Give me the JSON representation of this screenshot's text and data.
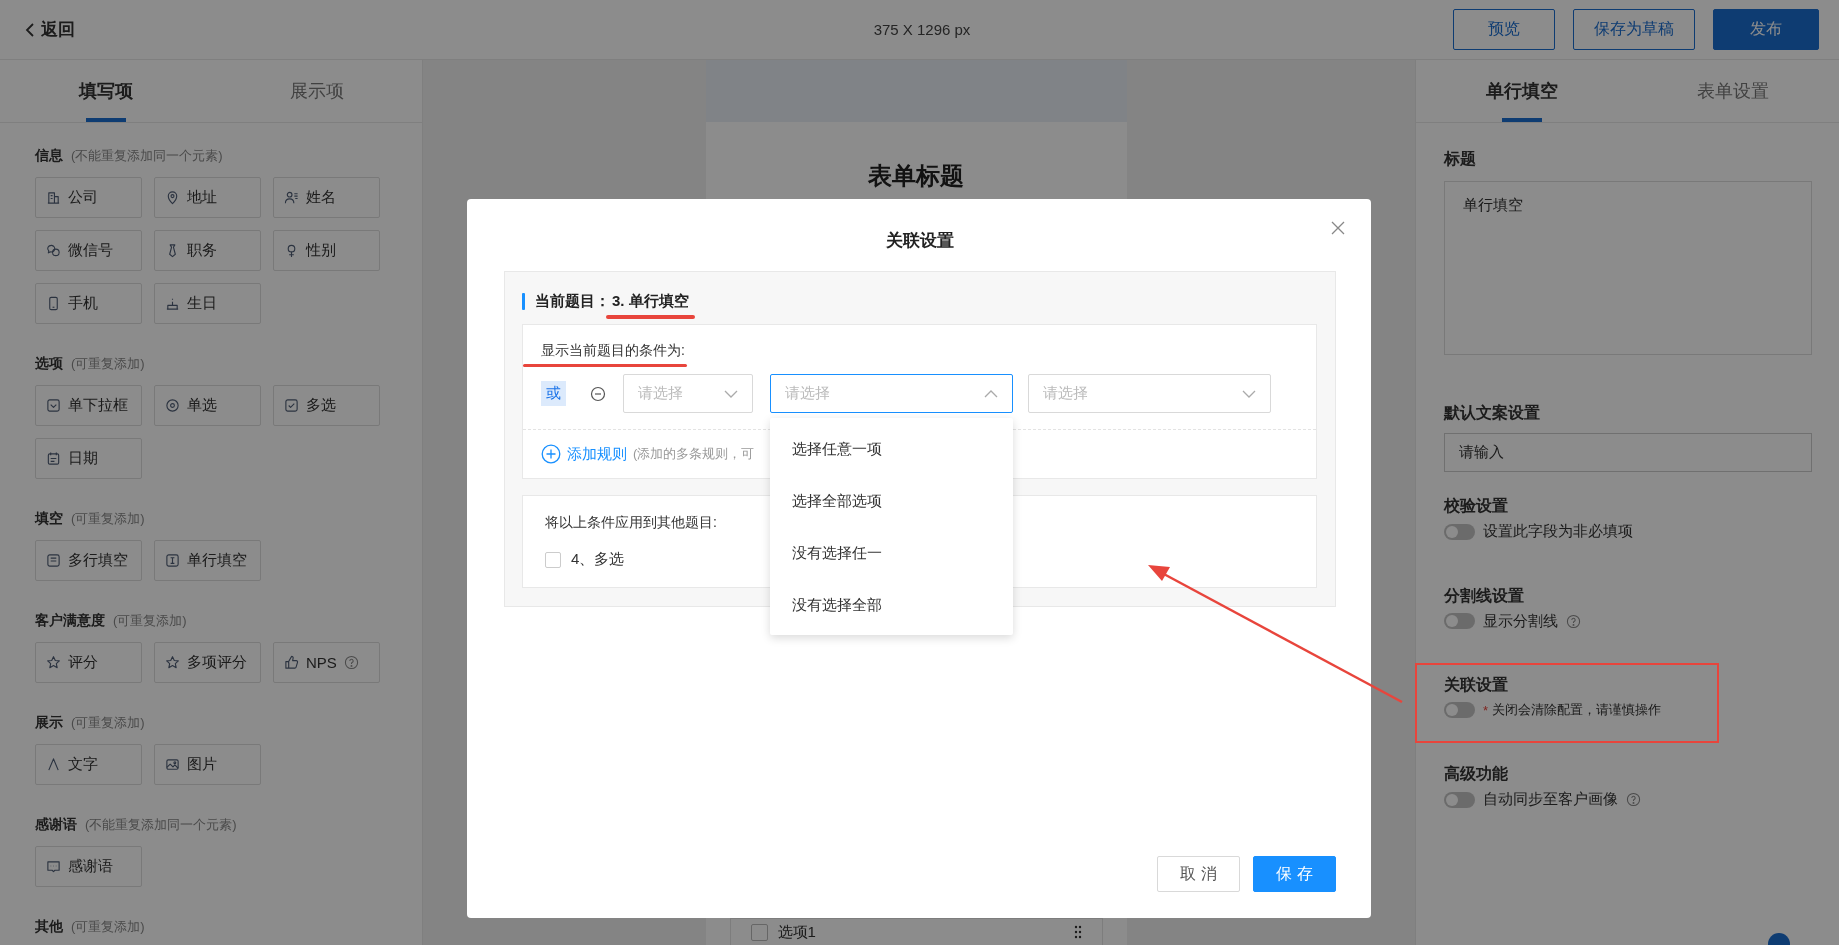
{
  "top_bar": {
    "back": "返回",
    "canvas_size": "375 X 1296 px",
    "buttons": [
      {
        "label": "预览",
        "kind": "outline"
      },
      {
        "label": "保存为草稿",
        "kind": "outline"
      },
      {
        "label": "发布",
        "kind": "primary"
      }
    ]
  },
  "left_panel": {
    "tabs": [
      {
        "label": "填写项",
        "selected": true
      },
      {
        "label": "展示项",
        "selected": false
      }
    ],
    "sections": [
      {
        "title": "信息",
        "hint": "(不能重复添加同一个元素)",
        "items": [
          {
            "label": "公司",
            "help": false
          },
          {
            "label": "地址",
            "help": false
          },
          {
            "label": "姓名",
            "help": false
          },
          {
            "label": "微信号",
            "help": false
          },
          {
            "label": "职务",
            "help": false
          },
          {
            "label": "性别",
            "help": false
          },
          {
            "label": "手机",
            "help": false
          },
          {
            "label": "生日",
            "help": false
          }
        ]
      },
      {
        "title": "选项",
        "hint": "(可重复添加)",
        "items": [
          {
            "label": "单下拉框",
            "help": false
          },
          {
            "label": "单选",
            "help": false
          },
          {
            "label": "多选",
            "help": false
          },
          {
            "label": "日期",
            "help": false
          }
        ]
      },
      {
        "title": "填空",
        "hint": "(可重复添加)",
        "items": [
          {
            "label": "多行填空",
            "help": false
          },
          {
            "label": "单行填空",
            "help": false
          }
        ]
      },
      {
        "title": "客户满意度",
        "hint": "(可重复添加)",
        "items": [
          {
            "label": "评分",
            "help": false
          },
          {
            "label": "多项评分",
            "help": false
          },
          {
            "label": "NPS",
            "help": true
          }
        ]
      },
      {
        "title": "展示",
        "hint": "(可重复添加)",
        "items": [
          {
            "label": "文字",
            "help": false
          },
          {
            "label": "图片",
            "help": false
          }
        ]
      },
      {
        "title": "感谢语",
        "hint": "(不能重复添加同一个元素)",
        "items": [
          {
            "label": "感谢语",
            "help": false
          }
        ]
      },
      {
        "title": "其他",
        "hint": "(可重复添加)"
      }
    ]
  },
  "canvas": {
    "form_title": "表单标题",
    "option_row": {
      "label": "选项1",
      "checked": false
    }
  },
  "right_panel": {
    "tabs": [
      {
        "label": "单行填空",
        "selected": true
      },
      {
        "label": "表单设置",
        "selected": false
      }
    ],
    "title_field": {
      "label": "标题",
      "value": "单行填空"
    },
    "default_text_field": {
      "label": "默认文案设置",
      "value": "请输入"
    },
    "toggles": [
      {
        "title": "校验设置",
        "on": false,
        "text": "设置此字段为非必填项",
        "help": false
      },
      {
        "title": "分割线设置",
        "on": false,
        "text": "显示分割线",
        "help": true
      },
      {
        "title": "关联设置",
        "on": false,
        "required_mark": "*",
        "text": "关闭会清除配置，请谨慎操作",
        "help": false
      },
      {
        "title": "高级功能",
        "on": false,
        "text": "自动同步至客户画像",
        "help": true
      }
    ]
  },
  "modal": {
    "title": "关联设置",
    "current_label": "当前题目：",
    "current_value": "3. 单行填空",
    "condition_label": "显示当前题目的条件为:",
    "connector": "或",
    "selects": [
      {
        "placeholder": "请选择",
        "expanded": false
      },
      {
        "placeholder": "请选择",
        "expanded": true,
        "options": [
          "选择任意一项",
          "选择全部选项",
          "没有选择任一",
          "没有选择全部"
        ]
      },
      {
        "placeholder": "请选择",
        "expanded": false
      }
    ],
    "add_rule": "添加规则",
    "add_rule_hint": "(添加的多条规则，可",
    "apply_label": "将以上条件应用到其他题目:",
    "apply_items": [
      {
        "label": "4、多选",
        "checked": false
      }
    ],
    "buttons": [
      {
        "label": "取 消",
        "kind": "default"
      },
      {
        "label": "保 存",
        "kind": "primary"
      }
    ]
  }
}
